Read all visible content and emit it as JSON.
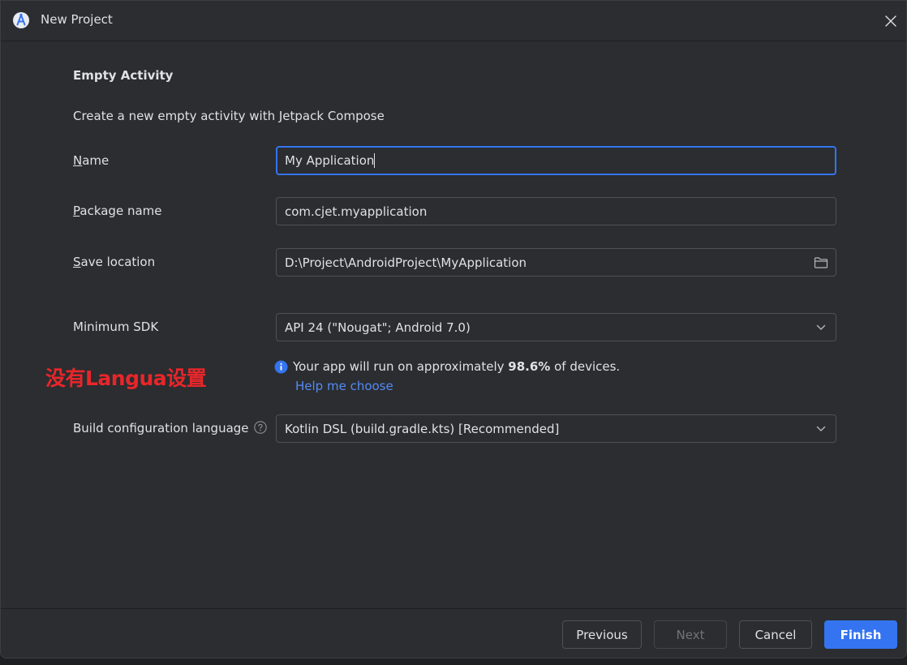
{
  "window": {
    "title": "New Project"
  },
  "template": {
    "title": "Empty Activity",
    "description": "Create a new empty activity with Jetpack Compose"
  },
  "form": {
    "name": {
      "label_mnemonic": "N",
      "label_rest": "ame",
      "value": "My Application"
    },
    "package_name": {
      "label_mnemonic": "P",
      "label_rest": "ackage name",
      "value": "com.cjet.myapplication"
    },
    "save_location": {
      "label_mnemonic": "S",
      "label_rest": "ave location",
      "value": "D:\\Project\\AndroidProject\\MyApplication"
    },
    "minimum_sdk": {
      "label": "Minimum SDK",
      "selected": "API 24 (\"Nougat\"; Android 7.0)"
    },
    "sdk_info": {
      "prefix": "Your app will run on approximately ",
      "percent": "98.6%",
      "suffix": " of devices.",
      "help_link": "Help me choose"
    },
    "build_language": {
      "label": "Build configuration language",
      "selected": "Kotlin DSL (build.gradle.kts) [Recommended]"
    }
  },
  "annotation": {
    "text": "没有Langua设置"
  },
  "buttons": {
    "previous": "Previous",
    "next": "Next",
    "cancel": "Cancel",
    "finish": "Finish"
  },
  "colors": {
    "accent": "#3574f0",
    "link": "#548af7",
    "annotation": "#e8262a",
    "background": "#2b2d30"
  },
  "icons": {
    "app": "android-studio-icon",
    "close": "close-icon",
    "folder": "folder-icon",
    "dropdown": "chevron-down-icon",
    "info": "info-icon",
    "help": "question-circle-icon"
  }
}
